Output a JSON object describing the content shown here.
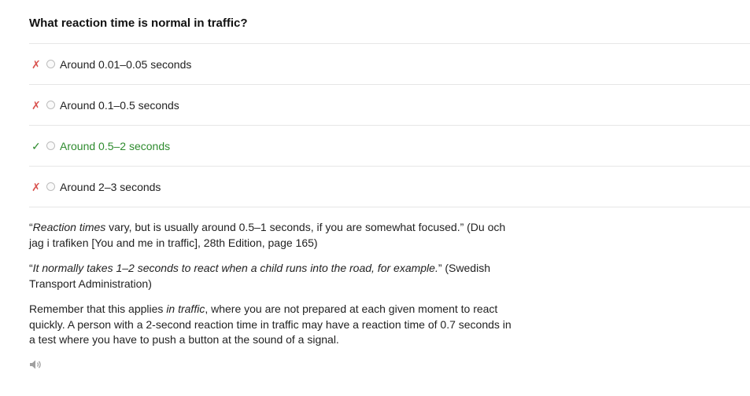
{
  "question": "What reaction time is normal in traffic?",
  "options": [
    {
      "mark": "✗",
      "status": "wrong",
      "label": "Around 0.01–0.05 seconds"
    },
    {
      "mark": "✗",
      "status": "wrong",
      "label": "Around 0.1–0.5 seconds"
    },
    {
      "mark": "✓",
      "status": "correct",
      "label": "Around 0.5–2 seconds"
    },
    {
      "mark": "✗",
      "status": "wrong",
      "label": "Around 2–3 seconds"
    }
  ],
  "explanation": {
    "p1": {
      "open_quote": "“",
      "em": "Reaction times",
      "rest": " vary, but is usually around 0.5–1 seconds, if you are somewhat focused.” (Du och jag i trafiken [You and me in traffic], 28th Edition, page 165)"
    },
    "p2": {
      "open_quote": "“",
      "em": "It normally takes 1–2 seconds to react when a child runs into the road, for example.",
      "rest": "” (Swedish Transport Administration)"
    },
    "p3": {
      "before": "Remember that this applies ",
      "em": "in traffic",
      "after": ", where you are not prepared at each given moment to react quickly. A person with a 2-second reaction time in traffic may have a reaction time of 0.7 seconds in a test where you have to push a button at the sound of a signal."
    }
  },
  "audio": {
    "icon": "speaker-icon"
  },
  "colors": {
    "correct": "#2e8b2e",
    "wrong": "#d9534f",
    "divider": "#e6e6e6"
  }
}
